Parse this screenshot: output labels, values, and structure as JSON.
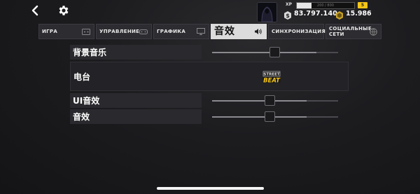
{
  "topbar": {
    "xp_label": "XP",
    "xp_text": "200 / 800",
    "xp_progress": 0.25,
    "level": "5",
    "cash": "83.797.140",
    "gold": "15.986"
  },
  "tabs": [
    {
      "label": "ИГРА",
      "icon": "gamepad-icon"
    },
    {
      "label": "УПРАВЛЕНИЕ",
      "icon": "controller-icon"
    },
    {
      "label": "ГРАФИКА",
      "icon": "monitor-icon"
    },
    {
      "label": "音效",
      "icon": "speaker-icon",
      "active": true
    },
    {
      "label": "СИНХРОНИЗАЦИЯ",
      "icon": "cloud-icon"
    },
    {
      "label": "СОЦИАЛЬНЫЕ СЕТИ",
      "icon": "globe-icon"
    }
  ],
  "settings": {
    "bgm": {
      "label": "背景音乐",
      "value": 0.83
    },
    "radio": {
      "label": "电台",
      "station_logo_text_top": "STREET",
      "station_logo_text_bottom": "BEAT"
    },
    "ui_sfx": {
      "label": "UI音效",
      "value": 0.75
    },
    "sfx": {
      "label": "音效",
      "value": 0.75
    }
  },
  "colors": {
    "accent_gold": "#f5c518",
    "active_tab": "#dcdcdc",
    "panel": "#2d2d31"
  }
}
